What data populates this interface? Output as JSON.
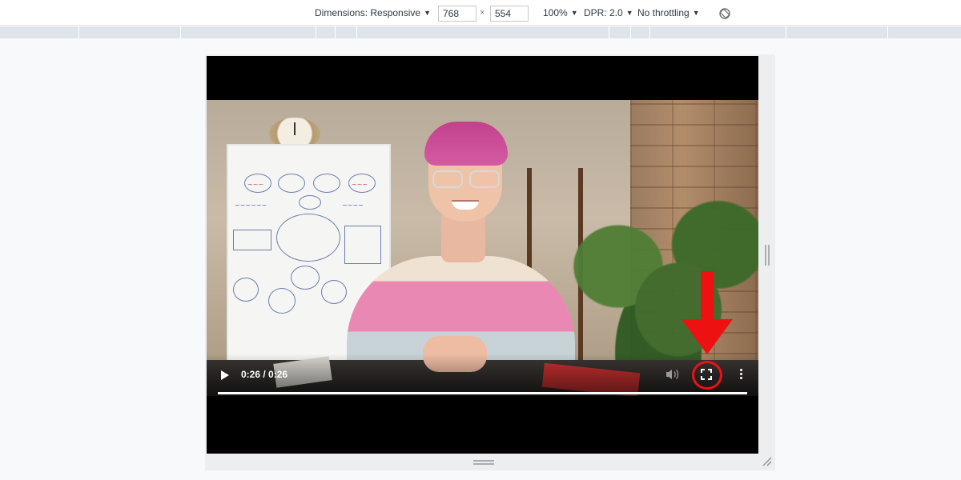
{
  "toolbar": {
    "dimensions_label": "Dimensions: Responsive",
    "width_value": "768",
    "height_value": "554",
    "times_symbol": "×",
    "zoom_label": "100%",
    "dpr_label": "DPR: 2.0",
    "throttling_label": "No throttling",
    "rotate_icon": "rotate-icon"
  },
  "video_player": {
    "time_display": "0:26 / 0:26",
    "progress": 1.0,
    "icons": [
      "play-icon",
      "volume-icon",
      "fullscreen-icon",
      "more-options-icon"
    ]
  },
  "annotation": {
    "color": "#ee1111",
    "target": "fullscreen-icon"
  },
  "colors": {
    "toolbar_bg": "#ffffff",
    "media_bar": "#dfe4ea",
    "canvas_bg": "#f8f9fa",
    "player_bg": "#000000"
  }
}
